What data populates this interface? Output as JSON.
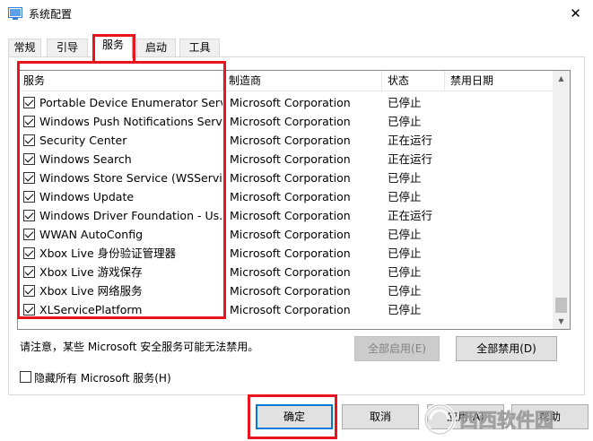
{
  "window": {
    "title": "系统配置",
    "close_glyph": "✕"
  },
  "tabs": [
    {
      "label": "常规"
    },
    {
      "label": "引导"
    },
    {
      "label": "服务",
      "active": true
    },
    {
      "label": "启动"
    },
    {
      "label": "工具"
    }
  ],
  "services": {
    "columns": [
      "服务",
      "制造商",
      "状态",
      "禁用日期"
    ],
    "rows": [
      {
        "name": "Portable Device Enumerator Serv...",
        "manufacturer": "Microsoft Corporation",
        "status": "已停止",
        "checked": true
      },
      {
        "name": "Windows Push Notifications Servi...",
        "manufacturer": "Microsoft Corporation",
        "status": "已停止",
        "checked": true
      },
      {
        "name": "Security Center",
        "manufacturer": "Microsoft Corporation",
        "status": "正在运行",
        "checked": true
      },
      {
        "name": "Windows Search",
        "manufacturer": "Microsoft Corporation",
        "status": "正在运行",
        "checked": true
      },
      {
        "name": "Windows Store Service (WSServi...",
        "manufacturer": "Microsoft Corporation",
        "status": "已停止",
        "checked": true
      },
      {
        "name": "Windows Update",
        "manufacturer": "Microsoft Corporation",
        "status": "已停止",
        "checked": true
      },
      {
        "name": "Windows Driver Foundation - Us...",
        "manufacturer": "Microsoft Corporation",
        "status": "正在运行",
        "checked": true
      },
      {
        "name": "WWAN AutoConfig",
        "manufacturer": "Microsoft Corporation",
        "status": "已停止",
        "checked": true
      },
      {
        "name": "Xbox Live 身份验证管理器",
        "manufacturer": "Microsoft Corporation",
        "status": "已停止",
        "checked": true
      },
      {
        "name": "Xbox Live 游戏保存",
        "manufacturer": "Microsoft Corporation",
        "status": "已停止",
        "checked": true
      },
      {
        "name": "Xbox Live 网络服务",
        "manufacturer": "Microsoft Corporation",
        "status": "已停止",
        "checked": true
      },
      {
        "name": "XLServicePlatform",
        "manufacturer": "Microsoft Corporation",
        "status": "已停止",
        "checked": true
      }
    ]
  },
  "notice": "请注意，某些 Microsoft 安全服务可能无法禁用。",
  "buttons": {
    "enable_all": "全部启用(E)",
    "disable_all": "全部禁用(D)",
    "ok": "确定",
    "cancel": "取消",
    "apply": "应用(A)",
    "help": "帮助"
  },
  "hide_ms": {
    "label": "隐藏所有 Microsoft 服务(H)",
    "checked": false
  },
  "watermark": "西西软件园",
  "colors": {
    "highlight": "#e8141e",
    "default_button_border": "#0078d7"
  }
}
